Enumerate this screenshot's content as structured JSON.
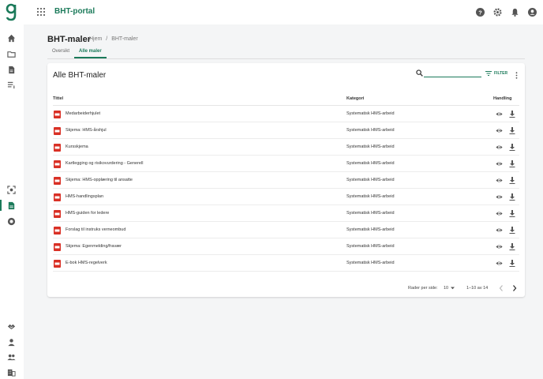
{
  "app": {
    "title": "BHT-portal"
  },
  "page": {
    "title": "BHT-maler",
    "breadcrumb": [
      "Hjem",
      "BHT-maler"
    ],
    "breadcrumb_separator": "/",
    "tabs": [
      {
        "label": "Oversikt",
        "active": false
      },
      {
        "label": "Alle maler",
        "active": true
      }
    ]
  },
  "card": {
    "title": "Alle BHT-maler",
    "search": {
      "value": "",
      "placeholder": ""
    },
    "filter_label": "FILTER",
    "columns": {
      "title": "Tittel",
      "category": "Kategori",
      "action": "Handling"
    },
    "rows": [
      {
        "title": "Medarbeiderhjulet",
        "category": "Systematisk HMS-arbeid"
      },
      {
        "title": "Skjema: HMS-årshjul",
        "category": "Systematisk HMS-arbeid"
      },
      {
        "title": "Kursskjema",
        "category": "Systematisk HMS-arbeid"
      },
      {
        "title": "Kartlegging og risikovurdering - Generell",
        "category": "Systematisk HMS-arbeid"
      },
      {
        "title": "Skjema: HMS-opplæring til ansatte",
        "category": "Systematisk HMS-arbeid"
      },
      {
        "title": "HMS-handlingsplan",
        "category": "Systematisk HMS-arbeid"
      },
      {
        "title": "HMS-guiden for ledere",
        "category": "Systematisk HMS-arbeid"
      },
      {
        "title": "Forslag til instruks verneombud",
        "category": "Systematisk HMS-arbeid"
      },
      {
        "title": "Skjema: Egenmelding/fravær",
        "category": "Systematisk HMS-arbeid"
      },
      {
        "title": "E-bok HMS-regelverk",
        "category": "Systematisk HMS-arbeid"
      }
    ],
    "pagination": {
      "rows_per_page_label": "Rader per side:",
      "rows_per_page": "10",
      "range": "1–10 av 14"
    }
  },
  "colors": {
    "accent": "#1b7a5a",
    "pdf": "#d93025"
  },
  "icons": {
    "top": [
      "help-icon",
      "settings-icon",
      "notifications-icon",
      "account-icon"
    ],
    "rail": [
      "home-icon",
      "folder-icon",
      "document-icon",
      "list-icon",
      "focus-icon",
      "templates-icon",
      "chat-icon",
      "handshake-icon",
      "person-icon",
      "group-icon",
      "company-icon"
    ]
  }
}
